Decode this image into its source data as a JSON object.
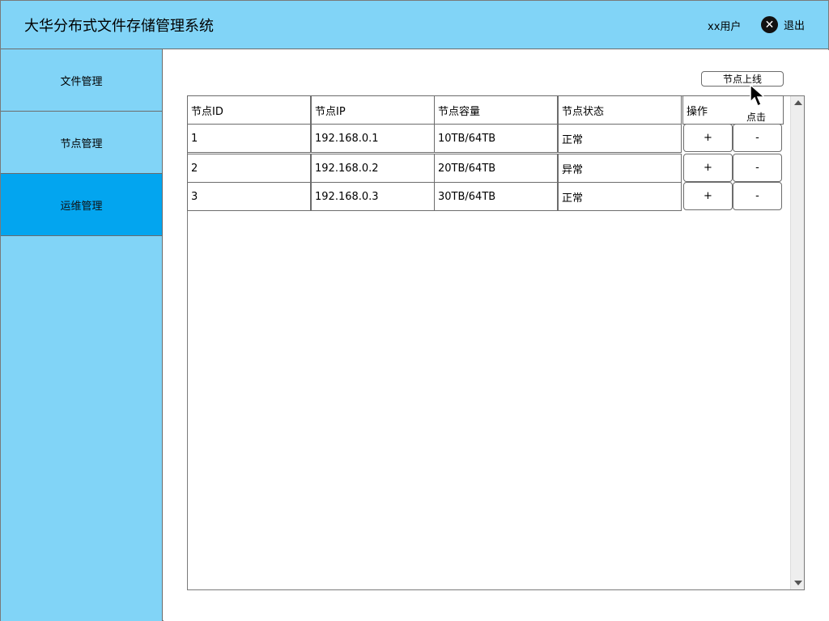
{
  "header": {
    "title": "大华分布式文件存储管理系统",
    "user": "xx用户",
    "logout_label": "退出",
    "logout_icon": "close-circle-icon"
  },
  "sidebar": {
    "items": [
      {
        "label": "文件管理",
        "active": false
      },
      {
        "label": "节点管理",
        "active": false
      },
      {
        "label": "运维管理",
        "active": true
      }
    ]
  },
  "toolbar": {
    "online_button_label": "节点上线",
    "click_hint": "点击"
  },
  "table": {
    "columns": [
      "节点ID",
      "节点IP",
      "节点容量",
      "节点状态",
      "操作"
    ],
    "rows": [
      {
        "id": "1",
        "ip": "192.168.0.1",
        "capacity": "10TB/64TB",
        "status": "正常"
      },
      {
        "id": "2",
        "ip": "192.168.0.2",
        "capacity": "20TB/64TB",
        "status": "异常"
      },
      {
        "id": "3",
        "ip": "192.168.0.3",
        "capacity": "30TB/64TB",
        "status": "正常"
      }
    ],
    "add_label": "+",
    "remove_label": "-"
  },
  "colors": {
    "header_bg": "#81d4f7",
    "sidebar_bg": "#81d4f7",
    "sidebar_active": "#03a5ef"
  }
}
